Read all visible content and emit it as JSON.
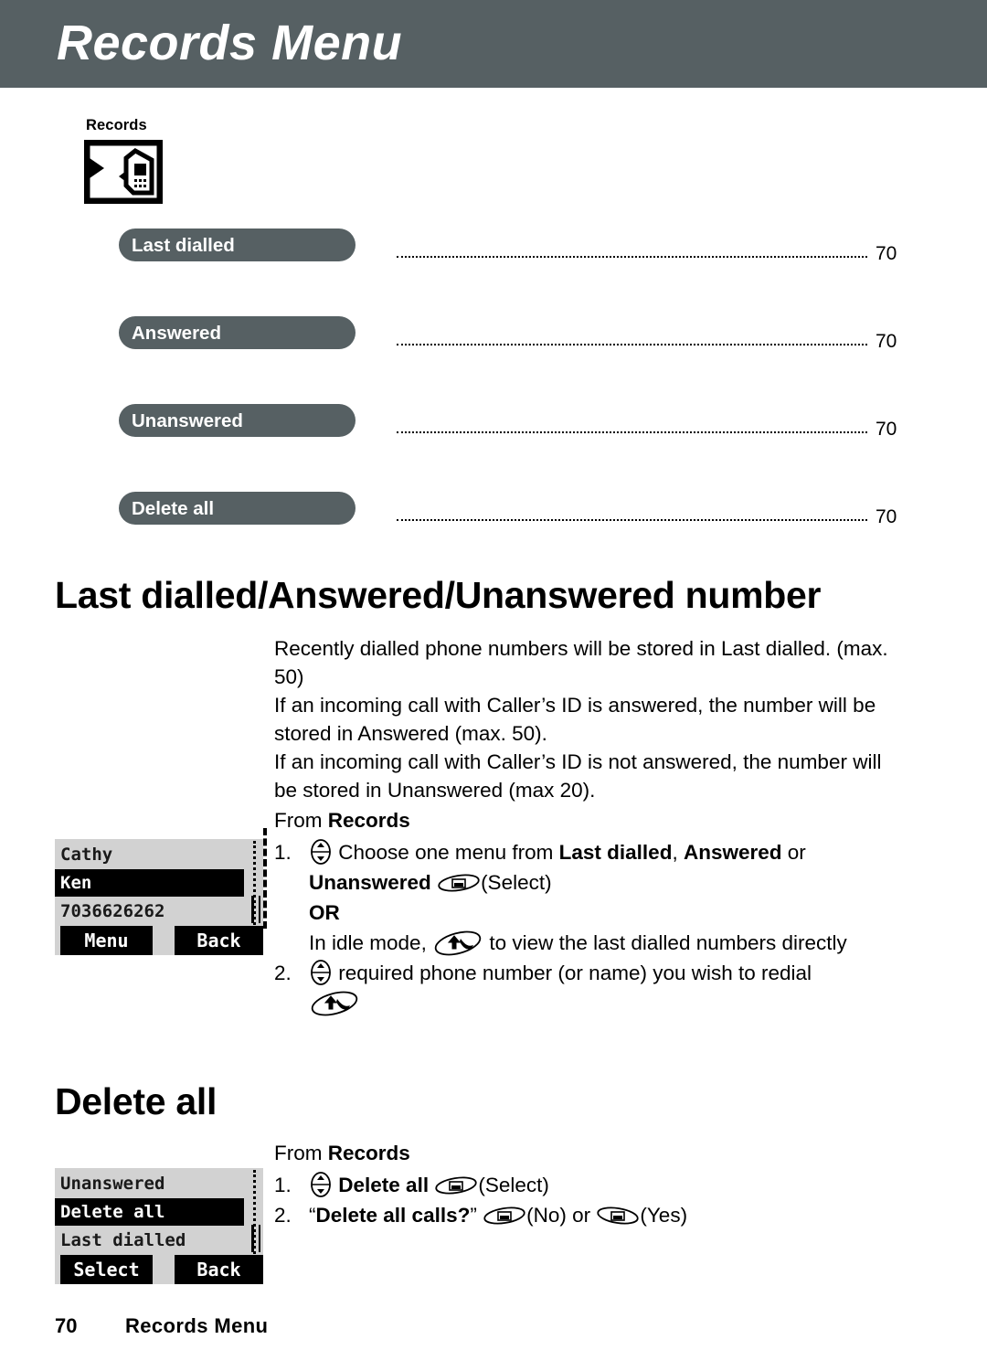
{
  "header": {
    "title": "Records Menu",
    "bar_color": "#566063"
  },
  "records_icon": {
    "caption": "Records",
    "icon": "records-phone-card-icon"
  },
  "toc": {
    "entries": [
      {
        "label": "Last dialled",
        "page": "70"
      },
      {
        "label": "Answered",
        "page": "70"
      },
      {
        "label": "Unanswered",
        "page": "70"
      },
      {
        "label": "Delete all",
        "page": "70"
      }
    ]
  },
  "sections": [
    {
      "heading": "Last dialled/Answered/Unanswered number",
      "intro": [
        "Recently dialled phone numbers will be stored in Last dialled. (max. 50)",
        "If an incoming call with Caller’s ID is answered, the number will be stored in Answered (max. 50).",
        "If an incoming call with Caller’s ID is not answered, the number will be stored in Unanswered (max 20)."
      ],
      "from_prefix": "From ",
      "from_target": "Records",
      "steps": {
        "one_num": "1.",
        "one_a_text": "Choose one menu from ",
        "one_a_bold1": "Last dialled",
        "one_a_mid": ", ",
        "one_a_bold2": "Answered",
        "one_a_tail": " or",
        "one_b_bold": "Unanswered",
        "one_b_tail": "(Select)",
        "or_label": "OR",
        "one_c_pre": "In idle mode, ",
        "one_c_post": " to view the last dialled numbers directly",
        "two_num": "2.",
        "two_text": "required phone number (or name) you wish to redial"
      }
    },
    {
      "heading": "Delete all",
      "from_prefix": "From ",
      "from_target": "Records",
      "steps": {
        "one_num": "1.",
        "one_bold": "Delete all",
        "one_tail": "(Select)",
        "two_num": "2.",
        "two_quote_open": "“",
        "two_bold": "Delete all calls?",
        "two_quote_close": "”",
        "two_no": "(No) or ",
        "two_yes": "(Yes)"
      }
    }
  ],
  "phone_mockups": [
    {
      "name": "records-list",
      "rows": [
        {
          "text": "Cathy",
          "selected": false
        },
        {
          "text": "Ken",
          "selected": true
        },
        {
          "text": "7036626262",
          "selected": false
        }
      ],
      "softkeys": {
        "left": "Menu",
        "right": "Back"
      }
    },
    {
      "name": "delete-all-menu",
      "rows": [
        {
          "text": "Unanswered",
          "selected": false
        },
        {
          "text": "Delete all",
          "selected": true
        },
        {
          "text": "Last dialled",
          "selected": false
        }
      ],
      "softkeys": {
        "left": "Select",
        "right": "Back"
      }
    }
  ],
  "footer": {
    "page_number": "70",
    "title": "Records Menu"
  }
}
